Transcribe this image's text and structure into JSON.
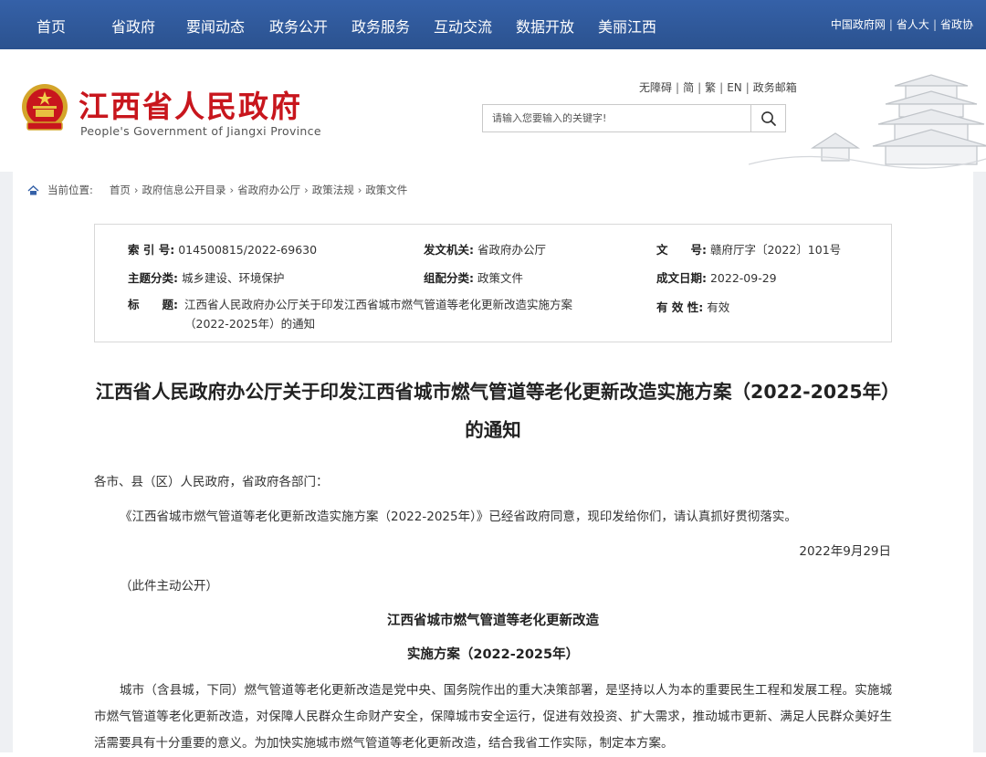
{
  "topnav": {
    "items": [
      "首页",
      "省政府",
      "要闻动态",
      "政务公开",
      "政务服务",
      "互动交流",
      "数据开放",
      "美丽江西"
    ],
    "right_links": [
      "中国政府网",
      "省人大",
      "省政协"
    ]
  },
  "header": {
    "site_name_cn": "江西省人民政府",
    "site_name_en": "People's Government of Jiangxi Province",
    "util_links": [
      "无障碍",
      "简",
      "繁",
      "EN",
      "政务邮箱"
    ],
    "search_placeholder": "请输入您要输入的关键字!"
  },
  "breadcrumb": {
    "label": "当前位置:",
    "items": [
      "首页",
      "政府信息公开目录",
      "省政府办公厅",
      "政策法规",
      "政策文件"
    ]
  },
  "meta": {
    "index_label": "索 引 号:",
    "index_value": "014500815/2022-69630",
    "issuer_label": "发文机关:",
    "issuer_value": "省政府办公厅",
    "docno_label": "文　　号:",
    "docno_value": "赣府厅字〔2022〕101号",
    "topic_label": "主题分类:",
    "topic_value": "城乡建设、环境保护",
    "category_label": "组配分类:",
    "category_value": "政策文件",
    "date_label": "成文日期:",
    "date_value": "2022-09-29",
    "title_label": "标　　题:",
    "title_value": "江西省人民政府办公厅关于印发江西省城市燃气管道等老化更新改造实施方案（2022-2025年）的通知",
    "validity_label": "有 效 性:",
    "validity_value": "有效"
  },
  "article": {
    "title": "江西省人民政府办公厅关于印发江西省城市燃气管道等老化更新改造实施方案（2022-2025年）的通知",
    "salutation": "各市、县（区）人民政府，省政府各部门：",
    "notice": "《江西省城市燃气管道等老化更新改造实施方案（2022-2025年）》已经省政府同意，现印发给你们，请认真抓好贯彻落实。",
    "date": "2022年9月29日",
    "public_note": "（此件主动公开）",
    "plan_title_line1": "江西省城市燃气管道等老化更新改造",
    "plan_title_line2": "实施方案（2022-2025年）",
    "body": "城市（含县城，下同）燃气管道等老化更新改造是党中央、国务院作出的重大决策部署，是坚持以人为本的重要民生工程和发展工程。实施城市燃气管道等老化更新改造，对保障人民群众生命财产安全，保障城市安全运行，促进有效投资、扩大需求，推动城市更新、满足人民群众美好生活需要具有十分重要的意义。为加快实施城市燃气管道等老化更新改造，结合我省工作实际，制定本方案。"
  },
  "colors": {
    "nav_bg": "#2f5597",
    "brand_red": "#c8161d"
  }
}
